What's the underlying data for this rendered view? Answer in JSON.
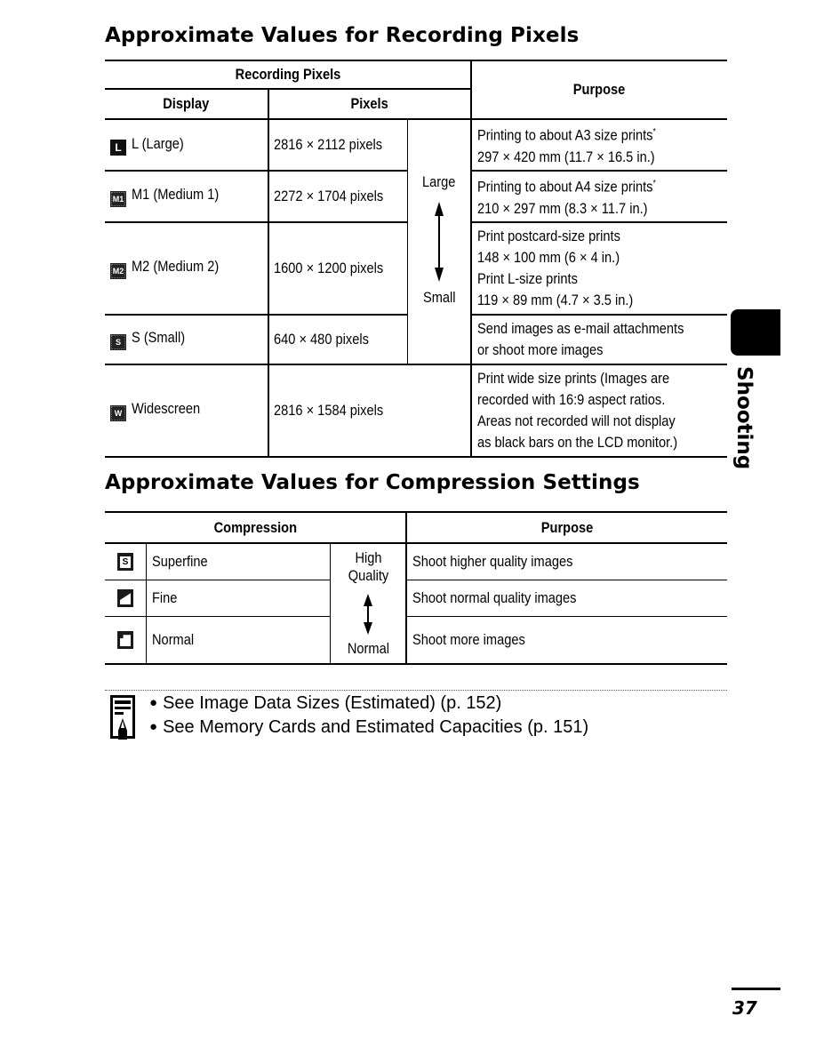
{
  "recording_section": {
    "title": "Approximate Values for Recording Pixels",
    "headers": {
      "group": "Recording Pixels",
      "display": "Display",
      "pixels": "Pixels",
      "purpose": "Purpose"
    },
    "size_scale": {
      "top": "Large",
      "bottom": "Small"
    },
    "rows": [
      {
        "icon": "L",
        "icon_name": "large-size-icon",
        "display": "L (Large)",
        "pixels": "2816 × 2112 pixels",
        "purpose_lines": [
          "Printing to about A3 size prints",
          "297 × 420 mm (11.7 × 16.5 in.)"
        ],
        "footnote_mark": "*"
      },
      {
        "icon": "M1",
        "icon_name": "medium1-size-icon",
        "display": "M1 (Medium 1)",
        "pixels": "2272 × 1704 pixels",
        "purpose_lines": [
          "Printing to about A4 size prints",
          "210 × 297 mm (8.3 × 11.7 in.)"
        ],
        "footnote_mark": "*"
      },
      {
        "icon": "M2",
        "icon_name": "medium2-size-icon",
        "display": "M2 (Medium 2)",
        "pixels": "1600 × 1200 pixels",
        "purpose_lines": [
          "Print postcard-size prints",
          "148 × 100 mm (6 × 4 in.)",
          "Print L-size prints",
          "119 × 89 mm (4.7 × 3.5 in.)"
        ],
        "footnote_mark": ""
      },
      {
        "icon": "S",
        "icon_name": "small-size-icon",
        "display": "S (Small)",
        "pixels": "640 × 480 pixels",
        "purpose_lines": [
          "Send images as e-mail attachments",
          "or shoot more images"
        ],
        "footnote_mark": ""
      },
      {
        "icon": "W",
        "icon_name": "widescreen-icon",
        "display": "Widescreen",
        "pixels": "2816 × 1584 pixels",
        "purpose_lines": [
          "Print wide size prints (Images are",
          "recorded with 16:9 aspect ratios.",
          "Areas not recorded will not display",
          "as black bars on the LCD monitor.)"
        ],
        "footnote_mark": ""
      }
    ]
  },
  "compression_section": {
    "title": "Approximate Values for Compression Settings",
    "headers": {
      "compression": "Compression",
      "purpose": "Purpose"
    },
    "quality_scale": {
      "top_line1": "High",
      "top_line2": "Quality",
      "bottom": "Normal"
    },
    "rows": [
      {
        "icon_name": "superfine-icon",
        "icon_glyph": "S",
        "name": "Superfine",
        "purpose": "Shoot higher quality images"
      },
      {
        "icon_name": "fine-icon",
        "icon_glyph": "",
        "name": "Fine",
        "purpose": "Shoot normal quality images"
      },
      {
        "icon_name": "normal-icon",
        "icon_glyph": "",
        "name": "Normal",
        "purpose": "Shoot more images"
      }
    ]
  },
  "notes": {
    "icon": "memo-pencil-icon",
    "items": [
      "See Image Data Sizes (Estimated) (p. 152)",
      "See Memory Cards and Estimated Capacities (p. 151)"
    ],
    "bullet": "●"
  },
  "side_tab": {
    "label": "Shooting"
  },
  "page_number": "37"
}
